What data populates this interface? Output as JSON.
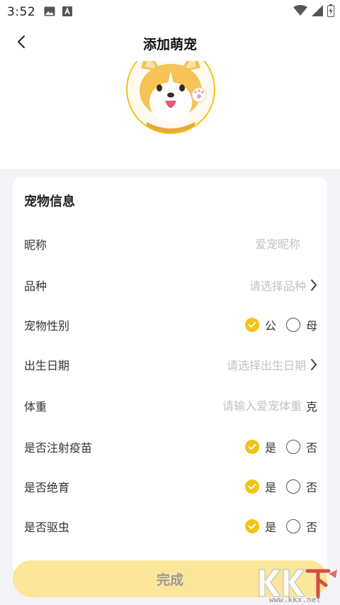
{
  "status_bar": {
    "time": "3:52"
  },
  "header": {
    "title": "添加萌宠"
  },
  "card": {
    "title": "宠物信息",
    "rows": {
      "nickname": {
        "label": "昵称",
        "placeholder": "爱宠昵称"
      },
      "breed": {
        "label": "品种",
        "placeholder": "请选择品种"
      },
      "gender": {
        "label": "宠物性别",
        "option_yes": "公",
        "option_no": "母",
        "selected": "公"
      },
      "birthday": {
        "label": "出生日期",
        "placeholder": "请选择出生日期"
      },
      "weight": {
        "label": "体重",
        "placeholder": "请输入爱宠体重",
        "unit": "克"
      },
      "vaccinated": {
        "label": "是否注射疫苗",
        "option_yes": "是",
        "option_no": "否",
        "selected": "是"
      },
      "neutered": {
        "label": "是否绝育",
        "option_yes": "是",
        "option_no": "否",
        "selected": "是"
      },
      "dewormed": {
        "label": "是否驱虫",
        "option_yes": "是",
        "option_no": "否",
        "selected": "是"
      }
    }
  },
  "footer": {
    "done_label": "完成"
  },
  "watermark": {
    "text": "KK下载",
    "url_text": "www.kkx.net"
  },
  "colors": {
    "accent": "#f2c316",
    "button_bg": "#fbe69a",
    "page_bg": "#f4f4f8"
  },
  "icons": [
    "gallery-icon",
    "font-app-icon",
    "wifi-icon",
    "signal-icon",
    "battery-icon",
    "back-chevron-icon",
    "chevron-right-icon",
    "check-icon"
  ]
}
